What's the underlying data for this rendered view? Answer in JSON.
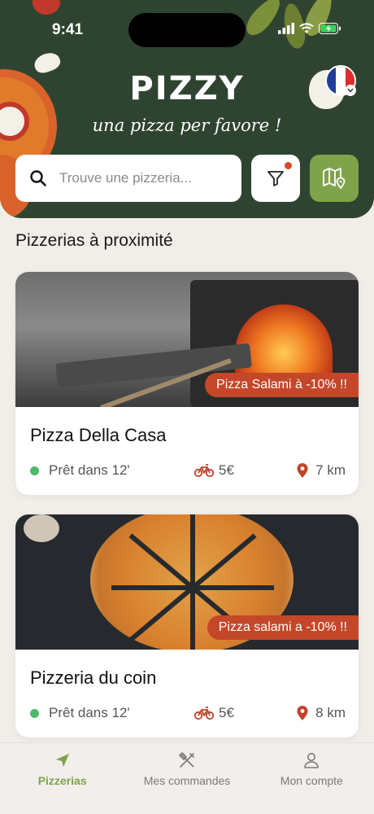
{
  "status_bar": {
    "time": "9:41"
  },
  "header": {
    "title": "PIZZY",
    "subtitle": "una pizza per favore !",
    "language": "fr"
  },
  "search": {
    "placeholder": "Trouve une pizzeria..."
  },
  "filter": {
    "has_active_filter": true
  },
  "section": {
    "title": "Pizzerias à proximité"
  },
  "pizzerias": [
    {
      "name": "Pizza Della Casa",
      "promo": "Pizza Salami à -10% !!",
      "ready": "Prêt dans 12'",
      "delivery_fee": "5€",
      "distance": "7 km",
      "image": "pizza-oven"
    },
    {
      "name": "Pizzeria du coin",
      "promo": "Pizza salami a -10% !!",
      "ready": "Prêt dans 12'",
      "delivery_fee": "5€",
      "distance": "8 km",
      "image": "sliced-pizza"
    }
  ],
  "tabs": [
    {
      "label": "Pizzerias",
      "icon": "navigation-arrow-icon",
      "active": true
    },
    {
      "label": "Mes commandes",
      "icon": "utensils-icon",
      "active": false
    },
    {
      "label": "Mon compte",
      "icon": "user-icon",
      "active": false
    }
  ],
  "colors": {
    "header_bg": "#2f4430",
    "accent_green": "#7fa34a",
    "promo_red": "#c5472a",
    "ready_green": "#4fb96a",
    "background": "#f1ede8"
  }
}
